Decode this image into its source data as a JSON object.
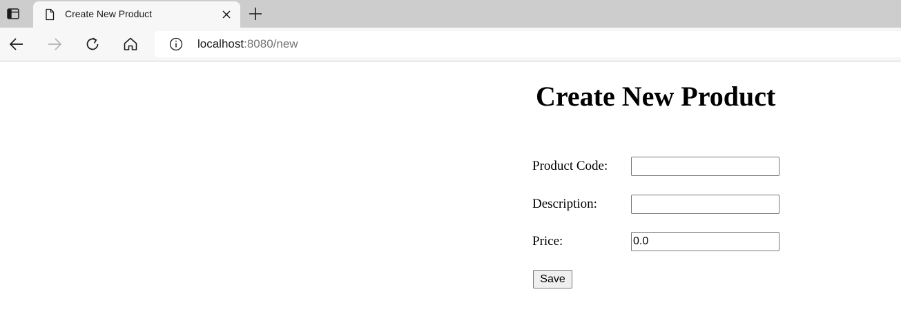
{
  "browser": {
    "tab": {
      "title": "Create New Product"
    },
    "address": {
      "host": "localhost",
      "rest": ":8080/new"
    },
    "icons": {
      "tab_actions": "tab-actions-icon",
      "page": "page-icon",
      "close": "close-icon",
      "new_tab": "plus-icon",
      "back": "back-arrow-icon",
      "forward": "forward-arrow-icon",
      "reload": "reload-icon",
      "home": "home-icon",
      "site_info": "info-icon"
    }
  },
  "page": {
    "heading": "Create New Product",
    "form": {
      "product_code": {
        "label": "Product Code:",
        "value": ""
      },
      "description": {
        "label": "Description:",
        "value": ""
      },
      "price": {
        "label": "Price:",
        "value": "0.0"
      },
      "save_label": "Save"
    }
  }
}
